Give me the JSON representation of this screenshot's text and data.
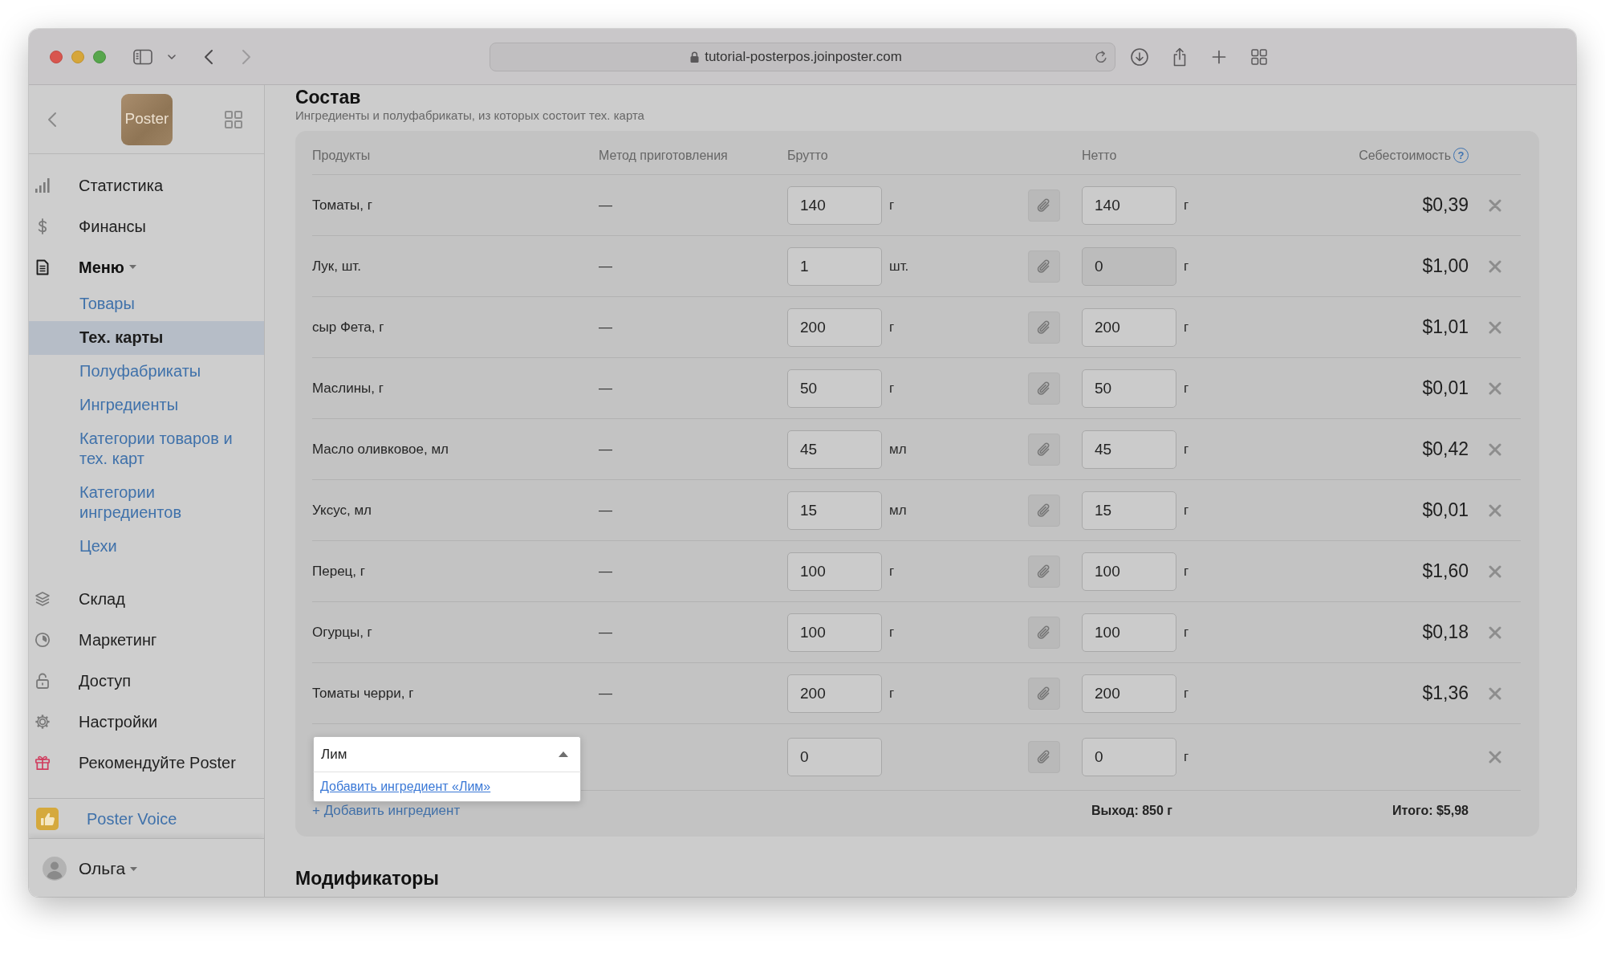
{
  "browser": {
    "url": "tutorial-posterpos.joinposter.com",
    "back_disabled": false,
    "forward_disabled": true
  },
  "sidebar": {
    "logo": "Poster",
    "nav": [
      {
        "label": "Статистика",
        "selected": false
      },
      {
        "label": "Финансы",
        "selected": false
      },
      {
        "label": "Меню",
        "selected": true,
        "expanded": true,
        "children": [
          {
            "label": "Товары",
            "selected": false
          },
          {
            "label": "Тех. карты",
            "selected": true
          },
          {
            "label": "Полуфабрикаты",
            "selected": false
          },
          {
            "label": "Ингредиенты",
            "selected": false
          },
          {
            "label": "Категории товаров и тех. карт",
            "selected": false
          },
          {
            "label": "Категории ингредиентов",
            "selected": false
          },
          {
            "label": "Цехи",
            "selected": false
          }
        ]
      },
      {
        "label": "Склад",
        "selected": false
      },
      {
        "label": "Маркетинг",
        "selected": false
      },
      {
        "label": "Доступ",
        "selected": false
      },
      {
        "label": "Настройки",
        "selected": false
      },
      {
        "label": "Рекомендуйте Poster",
        "selected": false
      }
    ],
    "promo": "Poster Voice",
    "user": "Ольга"
  },
  "composition": {
    "title": "Состав",
    "subtitle": "Ингредиенты и полуфабрикаты, из которых состоит тех. карта",
    "table": {
      "columns": [
        "Продукты",
        "Метод приготовления",
        "Брутто",
        "Нетто",
        "Себестоимость"
      ],
      "help": "?",
      "rows": [
        {
          "kind": "item",
          "product": "Томаты, г",
          "method": "—",
          "gross": "140",
          "gross_unit": "г",
          "net": "140",
          "net_unit": "г",
          "net_disabled": false,
          "cost": "$0,39"
        },
        {
          "kind": "item",
          "product": "Лук, шт.",
          "method": "—",
          "gross": "1",
          "gross_unit": "шт.",
          "net": "0",
          "net_unit": "г",
          "net_disabled": true,
          "cost": "$1,00"
        },
        {
          "kind": "item",
          "product": "сыр Фета, г",
          "method": "—",
          "gross": "200",
          "gross_unit": "г",
          "net": "200",
          "net_unit": "г",
          "net_disabled": false,
          "cost": "$1,01"
        },
        {
          "kind": "item",
          "product": "Маслины, г",
          "method": "—",
          "gross": "50",
          "gross_unit": "г",
          "net": "50",
          "net_unit": "г",
          "net_disabled": false,
          "cost": "$0,01"
        },
        {
          "kind": "item",
          "product": "Масло оливковое, мл",
          "method": "—",
          "gross": "45",
          "gross_unit": "мл",
          "net": "45",
          "net_unit": "г",
          "net_disabled": false,
          "cost": "$0,42"
        },
        {
          "kind": "item",
          "product": "Уксус, мл",
          "method": "—",
          "gross": "15",
          "gross_unit": "мл",
          "net": "15",
          "net_unit": "г",
          "net_disabled": false,
          "cost": "$0,01"
        },
        {
          "kind": "item",
          "product": "Перец, г",
          "method": "—",
          "gross": "100",
          "gross_unit": "г",
          "net": "100",
          "net_unit": "г",
          "net_disabled": false,
          "cost": "$1,60"
        },
        {
          "kind": "item",
          "product": "Огурцы, г",
          "method": "—",
          "gross": "100",
          "gross_unit": "г",
          "net": "100",
          "net_unit": "г",
          "net_disabled": false,
          "cost": "$0,18"
        },
        {
          "kind": "item",
          "product": "Томаты черри, г",
          "method": "—",
          "gross": "200",
          "gross_unit": "г",
          "net": "200",
          "net_unit": "г",
          "net_disabled": false,
          "cost": "$1,36"
        },
        {
          "kind": "new",
          "search": "Лим",
          "search_open": true,
          "suggestion": "Добавить ингредиент «Лим»",
          "gross": "0",
          "net": "0",
          "net_unit": "г",
          "net_disabled": false
        }
      ]
    },
    "add_link": "+ Добавить ингредиент",
    "yield": "Выход: 850 г",
    "total": "Итого: $5,98"
  },
  "modifiers": {
    "title": "Модификаторы"
  }
}
